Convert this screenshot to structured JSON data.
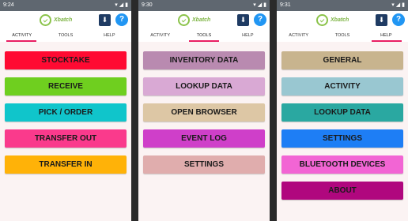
{
  "screens": [
    {
      "time": "9:24",
      "logo_text": "Xbatch",
      "tabs": [
        "ACTIVITY",
        "TOOLS",
        "HELP"
      ],
      "active_tab": 0,
      "buttons": [
        {
          "label": "STOCKTAKE",
          "color": "#ff0a32"
        },
        {
          "label": "RECEIVE",
          "color": "#6fcf1f"
        },
        {
          "label": "PICK / ORDER",
          "color": "#10c5cb"
        },
        {
          "label": "TRANSFER OUT",
          "color": "#fa3a8c"
        },
        {
          "label": "TRANSFER IN",
          "color": "#ffb208"
        }
      ]
    },
    {
      "time": "9:30",
      "logo_text": "Xbatch",
      "tabs": [
        "ACTIVITY",
        "TOOLS",
        "HELP"
      ],
      "active_tab": 1,
      "buttons": [
        {
          "label": "INVENTORY DATA",
          "color": "#b98ab0"
        },
        {
          "label": "LOOKUP DATA",
          "color": "#d9a9d4"
        },
        {
          "label": "OPEN BROWSER",
          "color": "#ddc7a5"
        },
        {
          "label": "EVENT LOG",
          "color": "#cf3fc9"
        },
        {
          "label": "SETTINGS",
          "color": "#e0adad"
        }
      ]
    },
    {
      "time": "9:31",
      "logo_text": "Xbatch",
      "tabs": [
        "ACTIVITY",
        "TOOLS",
        "HELP"
      ],
      "active_tab": 2,
      "buttons": [
        {
          "label": "GENERAL",
          "color": "#c8b48e"
        },
        {
          "label": "ACTIVITY",
          "color": "#99c7d1"
        },
        {
          "label": "LOOKUP DATA",
          "color": "#2aa8a1"
        },
        {
          "label": "SETTINGS",
          "color": "#1e7ef5"
        },
        {
          "label": "BLUETOOTH DEVICES",
          "color": "#f265d4"
        },
        {
          "label": "ABOUT",
          "color": "#b0077e"
        }
      ]
    }
  ]
}
